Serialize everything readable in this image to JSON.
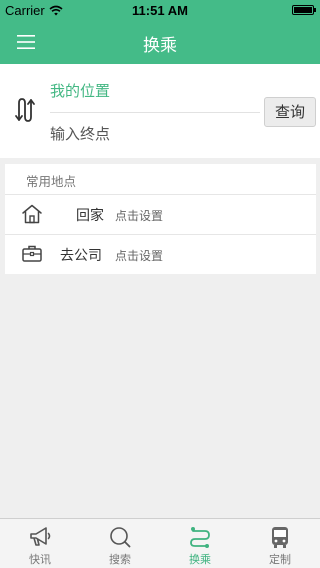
{
  "status_bar": {
    "carrier": "Carrier",
    "time": "11:51 AM"
  },
  "nav": {
    "title": "换乘",
    "menu_icon": "menu-icon"
  },
  "route": {
    "from_text": "我的位置",
    "to_placeholder": "输入终点",
    "query_label": "查询",
    "swap_icon": "swap-icon"
  },
  "favorites": {
    "header": "常用地点",
    "items": [
      {
        "icon": "home-icon",
        "label": "回家",
        "hint": "点击设置"
      },
      {
        "icon": "briefcase-icon",
        "label": "去公司",
        "hint": "点击设置"
      }
    ]
  },
  "tabs": [
    {
      "icon": "megaphone-icon",
      "label": "快讯",
      "active": false
    },
    {
      "icon": "search-icon",
      "label": "搜索",
      "active": false
    },
    {
      "icon": "transfer-icon",
      "label": "换乘",
      "active": true
    },
    {
      "icon": "bus-icon",
      "label": "定制",
      "active": false
    }
  ],
  "colors": {
    "brand_green": "#44bb88",
    "active_tab": "#3fb380",
    "from_text": "#43b783"
  }
}
